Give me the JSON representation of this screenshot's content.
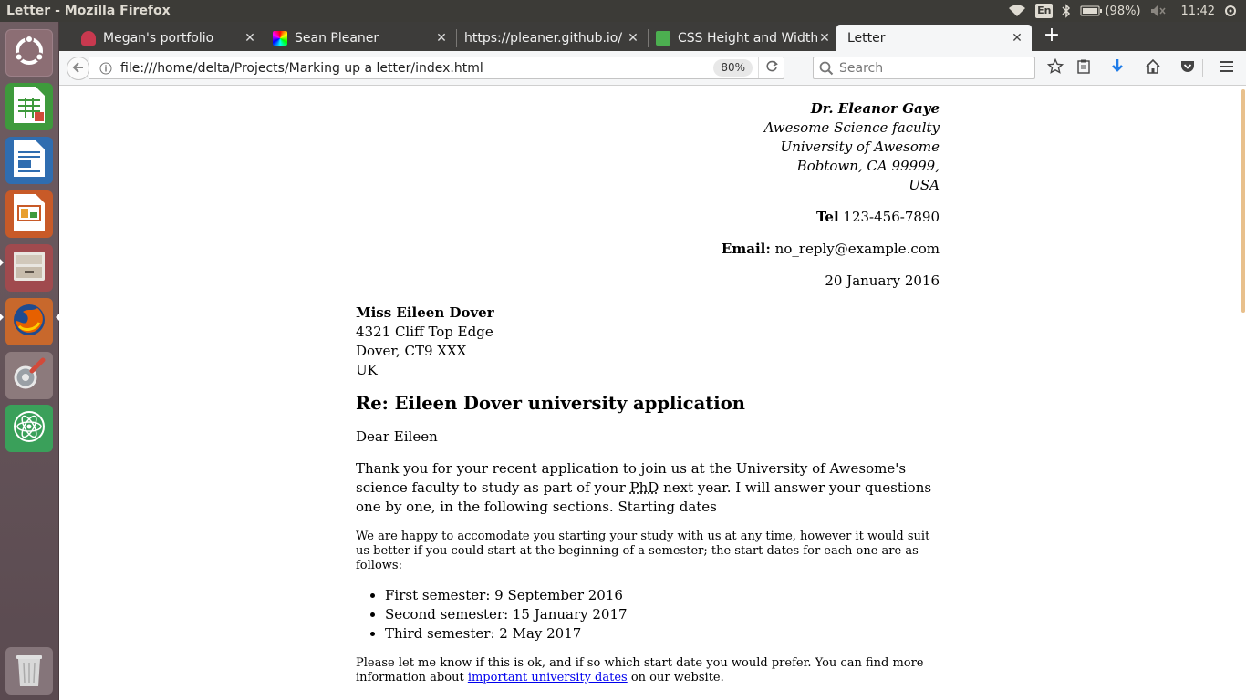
{
  "window": {
    "title": "Letter - Mozilla Firefox"
  },
  "system_tray": {
    "keyboard_layout": "En",
    "battery": "(98%)",
    "clock": "11:42"
  },
  "launcher": {
    "items": [
      {
        "name": "ubuntu-dash",
        "icon": "ubuntu-logo-icon"
      },
      {
        "name": "libreoffice-calc",
        "icon": "spreadsheet-icon"
      },
      {
        "name": "libreoffice-writer",
        "icon": "document-icon"
      },
      {
        "name": "libreoffice-impress",
        "icon": "presentation-icon"
      },
      {
        "name": "file-manager",
        "icon": "file-cabinet-icon"
      },
      {
        "name": "firefox",
        "icon": "firefox-icon"
      },
      {
        "name": "system-settings",
        "icon": "wrench-gear-icon"
      },
      {
        "name": "atom-editor",
        "icon": "atom-icon"
      },
      {
        "name": "trash",
        "icon": "trash-icon"
      }
    ]
  },
  "tabs": [
    {
      "label": "Megan's portfolio",
      "favicon_color": "#c8394f"
    },
    {
      "label": "Sean Pleaner",
      "favicon_color": "#7a3cff"
    },
    {
      "label": "https://pleaner.github.io/",
      "favicon_color": ""
    },
    {
      "label": "CSS Height and Width",
      "favicon_color": "#4caf50"
    },
    {
      "label": "Letter",
      "favicon_color": ""
    }
  ],
  "navbar": {
    "url": "file:///home/delta/Projects/Marking up a letter/index.html",
    "zoom": "80%",
    "search_placeholder": "Search"
  },
  "letter": {
    "sender": {
      "name": "Dr. Eleanor Gaye",
      "line1": "Awesome Science faculty",
      "line2": "University of Awesome",
      "line3": "Bobtown, CA 99999,",
      "line4": "USA"
    },
    "tel_label": "Tel",
    "tel_value": "123-456-7890",
    "email_label": "Email:",
    "email_value": "no_reply@example.com",
    "date": "20 January 2016",
    "recipient": {
      "name": "Miss Eileen Dover",
      "line1": "4321 Cliff Top Edge",
      "line2": "Dover, CT9 XXX",
      "line3": "UK"
    },
    "subject": "Re: Eileen Dover university application",
    "greeting": "Dear Eileen",
    "intro_part1": "Thank you for your recent application to join us at the University of Awesome's science faculty to study as part of your ",
    "intro_abbr": "PhD",
    "intro_part2": " next year. I will answer your questions one by one, in the following sections. Starting dates",
    "start_dates_para": "We are happy to accomodate you starting your study with us at any time, however it would suit us better if you could start at the beginning of a semester; the start dates for each one are as follows:",
    "semesters": [
      "First semester: 9 September 2016",
      "Second semester: 15 January 2017",
      "Third semester: 2 May 2017"
    ],
    "closing_part1": "Please let me know if this is ok, and if so which start date you would prefer. You can find more information about ",
    "closing_link": "important university dates",
    "closing_part2": " on our website."
  }
}
